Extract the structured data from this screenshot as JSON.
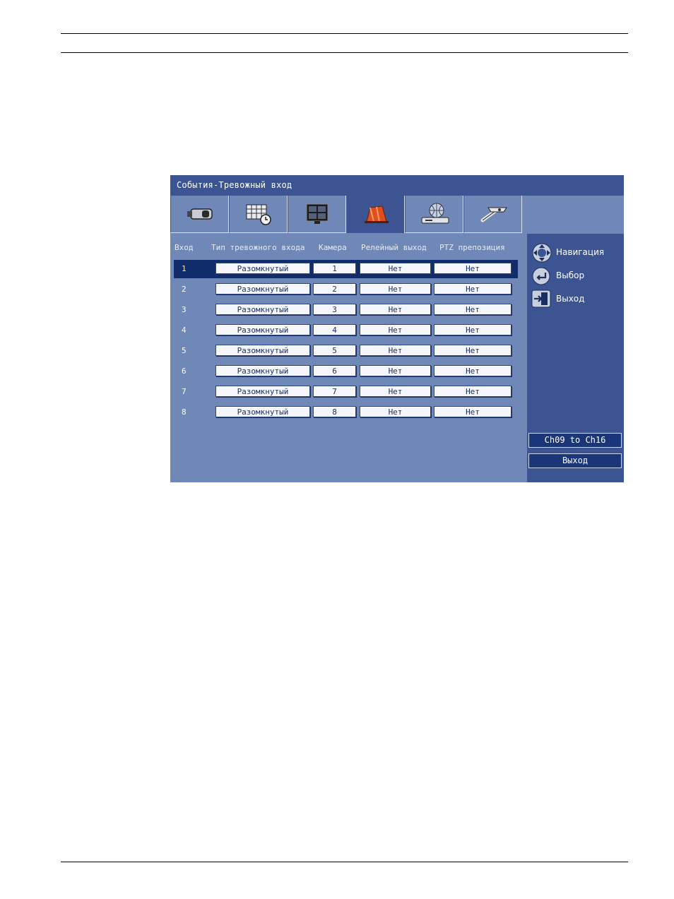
{
  "window": {
    "title": "События-Тревожный вход"
  },
  "tabs": [
    {
      "icon": "camera-icon",
      "active": false
    },
    {
      "icon": "schedule-icon",
      "active": false
    },
    {
      "icon": "monitor-icon",
      "active": false
    },
    {
      "icon": "alarm-icon",
      "active": true
    },
    {
      "icon": "network-icon",
      "active": false
    },
    {
      "icon": "tools-icon",
      "active": false
    }
  ],
  "table": {
    "headers": [
      "Вход",
      "Тип тревожного входа",
      "Камера",
      "Релейный выход",
      "PTZ препозиция"
    ],
    "rows": [
      {
        "input": "1",
        "type": "Разомкнутый",
        "camera": "1",
        "relay": "Нет",
        "ptz": "Нет",
        "selected": true
      },
      {
        "input": "2",
        "type": "Разомкнутый",
        "camera": "2",
        "relay": "Нет",
        "ptz": "Нет"
      },
      {
        "input": "3",
        "type": "Разомкнутый",
        "camera": "3",
        "relay": "Нет",
        "ptz": "Нет"
      },
      {
        "input": "4",
        "type": "Разомкнутый",
        "camera": "4",
        "relay": "Нет",
        "ptz": "Нет"
      },
      {
        "input": "5",
        "type": "Разомкнутый",
        "camera": "5",
        "relay": "Нет",
        "ptz": "Нет"
      },
      {
        "input": "6",
        "type": "Разомкнутый",
        "camera": "6",
        "relay": "Нет",
        "ptz": "Нет"
      },
      {
        "input": "7",
        "type": "Разомкнутый",
        "camera": "7",
        "relay": "Нет",
        "ptz": "Нет"
      },
      {
        "input": "8",
        "type": "Разомкнутый",
        "camera": "8",
        "relay": "Нет",
        "ptz": "Нет"
      }
    ]
  },
  "side": {
    "legend": [
      {
        "icon": "navigation-dpad-icon",
        "label": "Навигация"
      },
      {
        "icon": "enter-icon",
        "label": "Выбор"
      },
      {
        "icon": "exit-icon",
        "label": "Выход"
      }
    ],
    "channel_button": "Ch09 to Ch16",
    "exit_button": "Выход"
  },
  "colors": {
    "panel_dark": "#3c5592",
    "panel_light": "#7088b8",
    "selected_row": "#102c6a",
    "alarm_tab_icon": "#e0501e"
  }
}
